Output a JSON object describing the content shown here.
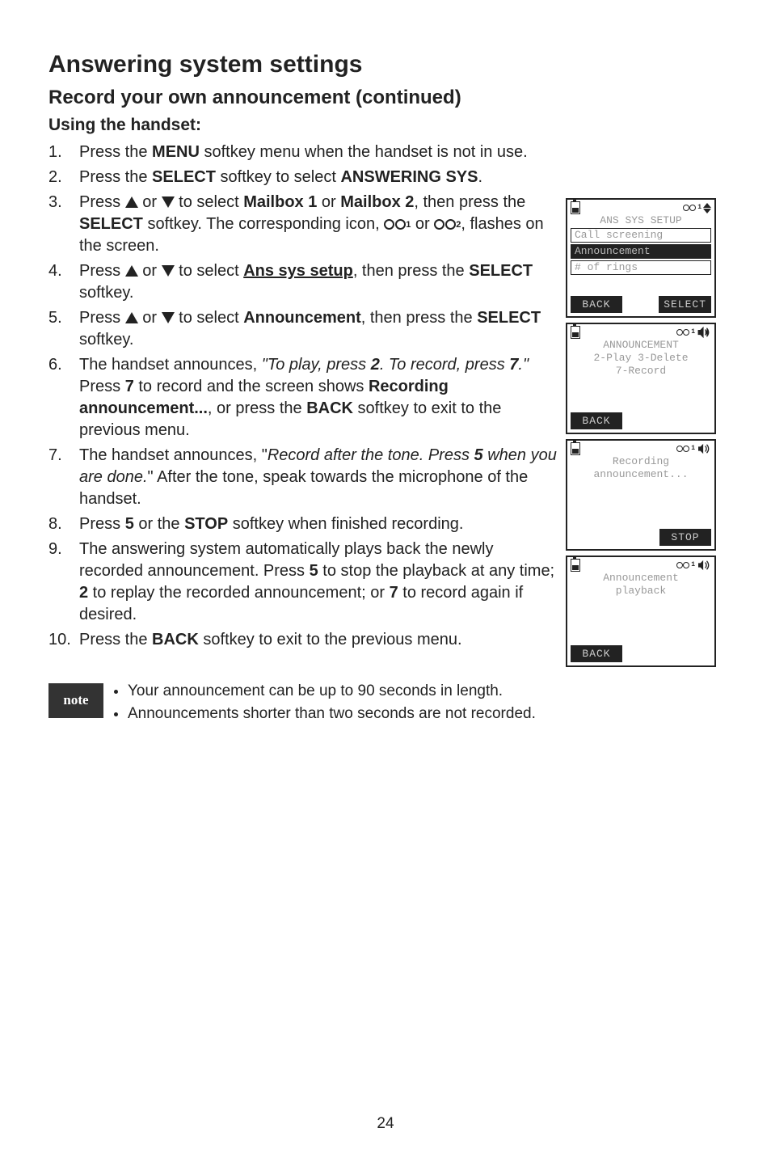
{
  "page_title": "Answering system settings",
  "subtitle": "Record your own announcement (continued)",
  "using_heading": "Using the handset:",
  "steps": {
    "s1_b": "MENU",
    "s2_b1": "SELECT",
    "s2_b2": "ANSWERING SYS",
    "s3_b1": "Mailbox 1",
    "s3_b2": "Mailbox 2",
    "s3_b3": "SELECT",
    "s4_b1": "Ans sys setup",
    "s4_b2": "SELECT",
    "s5_b1": "Announcement",
    "s5_b2": "SELECT",
    "s6_i1": "\"To play, press ",
    "s6_ib": "2",
    "s6_i2": ". To record, press ",
    "s6_ib2": "7",
    "s6_i3": ".\"",
    "s6_t1": "  Press ",
    "s6_b1": "7",
    "s6_t2": " to record and the screen shows ",
    "s6_b2": "Recording announcement...",
    "s6_t3": ", or press the ",
    "s6_b3": "BACK",
    "s6_t4": " softkey to exit to the previous menu.",
    "s7_t1": "The handset announces, \"",
    "s7_i1": "Record after the tone. Press ",
    "s7_ib": "5",
    "s7_i2": " when you are done.",
    "s7_t2": "\" After the tone, speak towards the microphone of the handset.",
    "s8_b1": "5",
    "s8_b2": "STOP",
    "s9_b1": "5",
    "s9_b2": "2",
    "s9_b3": "7",
    "s10_b": "BACK"
  },
  "screens": {
    "s1": {
      "title": "ANS SYS SETUP",
      "line1": "Call screening",
      "hl": "Announcement",
      "line2": "# of rings",
      "left": "BACK",
      "right": "SELECT"
    },
    "s2": {
      "title": "ANNOUNCEMENT",
      "line1": "2-Play 3-Delete",
      "line2": "7-Record",
      "left": "BACK"
    },
    "s3": {
      "line1": "Recording",
      "line2": "announcement...",
      "right": "STOP"
    },
    "s4": {
      "line1": "Announcement",
      "line2": "playback",
      "left": "BACK"
    }
  },
  "note_label": "note",
  "note1": "Your announcement can be up to 90 seconds in length.",
  "note2": "Announcements shorter than two seconds are not recorded.",
  "page_number": "24"
}
